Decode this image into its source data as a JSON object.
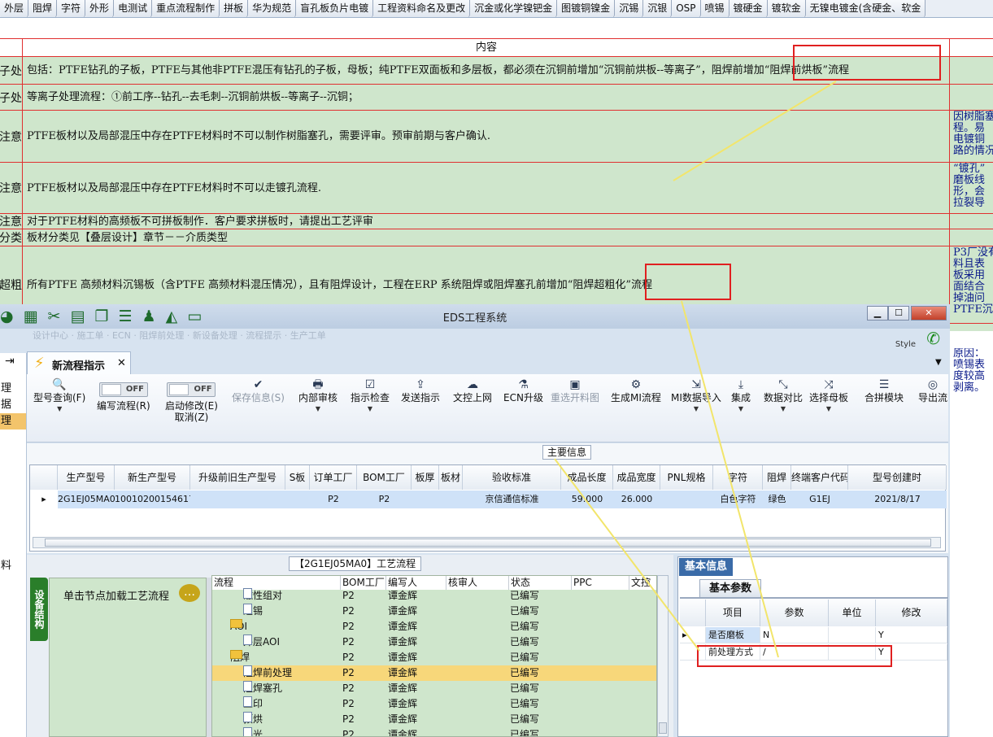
{
  "top_tabs": [
    "外层",
    "阻焊",
    "字符",
    "外形",
    "电测试",
    "重点流程制作",
    "拼板",
    "华为规范",
    "盲孔板负片电镀",
    "工程资料命名及更改",
    "沉金或化学镍钯金",
    "图镀铜镍金",
    "沉锡",
    "沉银",
    "OSP",
    "喷锡",
    "镀硬金",
    "镀软金",
    "无镍电镀金(含硬金、软金"
  ],
  "sheet": {
    "header": "内容",
    "rows": [
      {
        "c0": "子处",
        "c1": "包括：PTFE钻孔的子板，PTFE与其他非PTFE混压有钻孔的子板，母板；纯PTFE双面板和多层板，都必须在沉铜前增加“沉铜前烘板--等离子”，阻焊前增加“阻焊前烘板”流程",
        "c2": ""
      },
      {
        "c0": "子处",
        "c1": "等离子处理流程：①前工序--钻孔--去毛刺--沉铜前烘板--等离子--沉铜；",
        "c2": ""
      },
      {
        "c0": "注意",
        "c1": "PTFE板材以及局部混压中存在PTFE材料时不可以制作树脂塞孔，需要评审。预审前期与客户确认.",
        "c2": "因树脂塞\n程。易\n电镀铜\n路的情况"
      },
      {
        "c0": "注意",
        "c1": "PTFE板材以及局部混压中存在PTFE材料时不可以走镀孔流程.",
        "c2": "“镀孔”\n磨板线\n形，会\n拉裂导"
      },
      {
        "c0": "注意",
        "c1": "对于PTFE材料的高频板不可拼板制作．客户要求拼板时，请提出工艺评审",
        "c2": ""
      },
      {
        "c0": "分类",
        "c1": "板材分类见【叠层设计】章节－－介质类型",
        "c2": ""
      },
      {
        "c0": "超粗",
        "c1": "所有PTFE 高频材料沉锡板（含PTFE 高频材料混压情况），且有阻焊设计，工程在ERP 系统阻焊或阻焊塞孔前增加“阻焊超粗化”流程",
        "c2": "P3厂没有\n料且表\n板采用\n面结合\n掉油问\nPTFE沉"
      }
    ],
    "extra_c2": "原因：\n喷锡表\n度较高\n剥离。"
  },
  "window": {
    "title": "EDS工程系统",
    "style_label": "Style",
    "blurred_text": "设计中心 · 施工单 · ECN · 阻焊前处理 · 新设备处理 · 流程提示 · 生产工单",
    "doc_tab": "新流程指示",
    "left_nav": [
      "理",
      "据",
      "理",
      "",
      "",
      "料"
    ],
    "ribbon": [
      {
        "icon": "🔍",
        "label": "型号查询(F)",
        "dd": true
      },
      {
        "icon": "",
        "label": "编写流程(R)",
        "toggle": "OFF"
      },
      {
        "icon": "",
        "label": "启动修改(E)\n取消(Z)",
        "toggle": "OFF"
      },
      {
        "icon": "✔",
        "label": "保存信息(S)",
        "disabled": true
      },
      {
        "icon": "🖶",
        "label": "内部审核",
        "dd": true
      },
      {
        "icon": "☑",
        "label": "指示检查",
        "dd": true
      },
      {
        "icon": "⇪",
        "label": "发送指示"
      },
      {
        "icon": "☁",
        "label": "文控上网"
      },
      {
        "icon": "⚗",
        "label": "ECN升级"
      },
      {
        "icon": "▣",
        "label": "重选开料图",
        "disabled": true
      },
      {
        "icon": "⚙",
        "label": "生成MI流程"
      },
      {
        "icon": "⇲",
        "label": "MI数据导入",
        "dd": true
      },
      {
        "icon": "⤓",
        "label": "集成",
        "dd": true
      },
      {
        "icon": "⤡",
        "label": "数据对比",
        "dd": true
      },
      {
        "icon": "⤨",
        "label": "选择母板",
        "dd": true
      },
      {
        "icon": "☰",
        "label": "合拼模块"
      },
      {
        "icon": "◎",
        "label": "导出流"
      }
    ],
    "main_info": {
      "legend": "主要信息",
      "columns": [
        "生产型号",
        "新生产型号",
        "升级前旧生产型号",
        "S板",
        "订单工厂",
        "BOM工厂",
        "板厚",
        "板材",
        "验收标准",
        "成品长度",
        "成品宽度",
        "PNL规格",
        "字符",
        "阻焊",
        "终端客户代码",
        "型号创建时"
      ],
      "row": [
        "2G1EJ05MA0",
        "10010200154617",
        "",
        "",
        "P2",
        "P2",
        "",
        "",
        "京信通信标准",
        "59.000",
        "26.000",
        "",
        "白色字符",
        "绿色",
        "G1EJ",
        "2021/8/17"
      ]
    },
    "process": {
      "legend": "【2G1EJ05MA0】工艺流程",
      "vertical_tab": "设备结构",
      "node_hint": "单击节点加载工艺流程",
      "columns": [
        "流程",
        "BOM工厂",
        "编写人",
        "核审人",
        "状态",
        "PPC",
        "文控"
      ],
      "rows": [
        {
          "name": "磁性组对",
          "type": "doc",
          "indent": 2,
          "bom": "P2",
          "writer": "谭金辉",
          "status": "已编写",
          "sel": false
        },
        {
          "name": "退锡",
          "type": "doc",
          "indent": 2,
          "bom": "P2",
          "writer": "谭金辉",
          "status": "已编写",
          "sel": false
        },
        {
          "name": "AOI",
          "type": "folder",
          "indent": 1,
          "bom": "P2",
          "writer": "谭金辉",
          "status": "已编写",
          "sel": false
        },
        {
          "name": "外层AOI",
          "type": "doc",
          "indent": 2,
          "bom": "P2",
          "writer": "谭金辉",
          "status": "已编写",
          "sel": false
        },
        {
          "name": "阻焊",
          "type": "folder",
          "indent": 1,
          "bom": "P2",
          "writer": "谭金辉",
          "status": "已编写",
          "sel": false
        },
        {
          "name": "阻焊前处理",
          "type": "doc",
          "indent": 2,
          "bom": "P2",
          "writer": "谭金辉",
          "status": "已编写",
          "sel": true
        },
        {
          "name": "阻焊塞孔",
          "type": "doc",
          "indent": 2,
          "bom": "P2",
          "writer": "谭金辉",
          "status": "已编写",
          "sel": false
        },
        {
          "name": "丝印",
          "type": "doc",
          "indent": 2,
          "bom": "P2",
          "writer": "谭金辉",
          "status": "已编写",
          "sel": false
        },
        {
          "name": "预烘",
          "type": "doc",
          "indent": 2,
          "bom": "P2",
          "writer": "谭金辉",
          "status": "已编写",
          "sel": false
        },
        {
          "name": "曝光",
          "type": "doc",
          "indent": 2,
          "bom": "P2",
          "writer": "谭金辉",
          "status": "已编写",
          "sel": false
        }
      ]
    },
    "basic": {
      "tab": "基本信息",
      "subtab": "基本参数",
      "columns": [
        "项目",
        "参数",
        "单位",
        "修改"
      ],
      "rows": [
        {
          "item": "是否磨板",
          "param": "N",
          "unit": "",
          "mod": "Y"
        },
        {
          "item": "前处理方式",
          "param": "/",
          "unit": "",
          "mod": "Y"
        }
      ]
    }
  }
}
